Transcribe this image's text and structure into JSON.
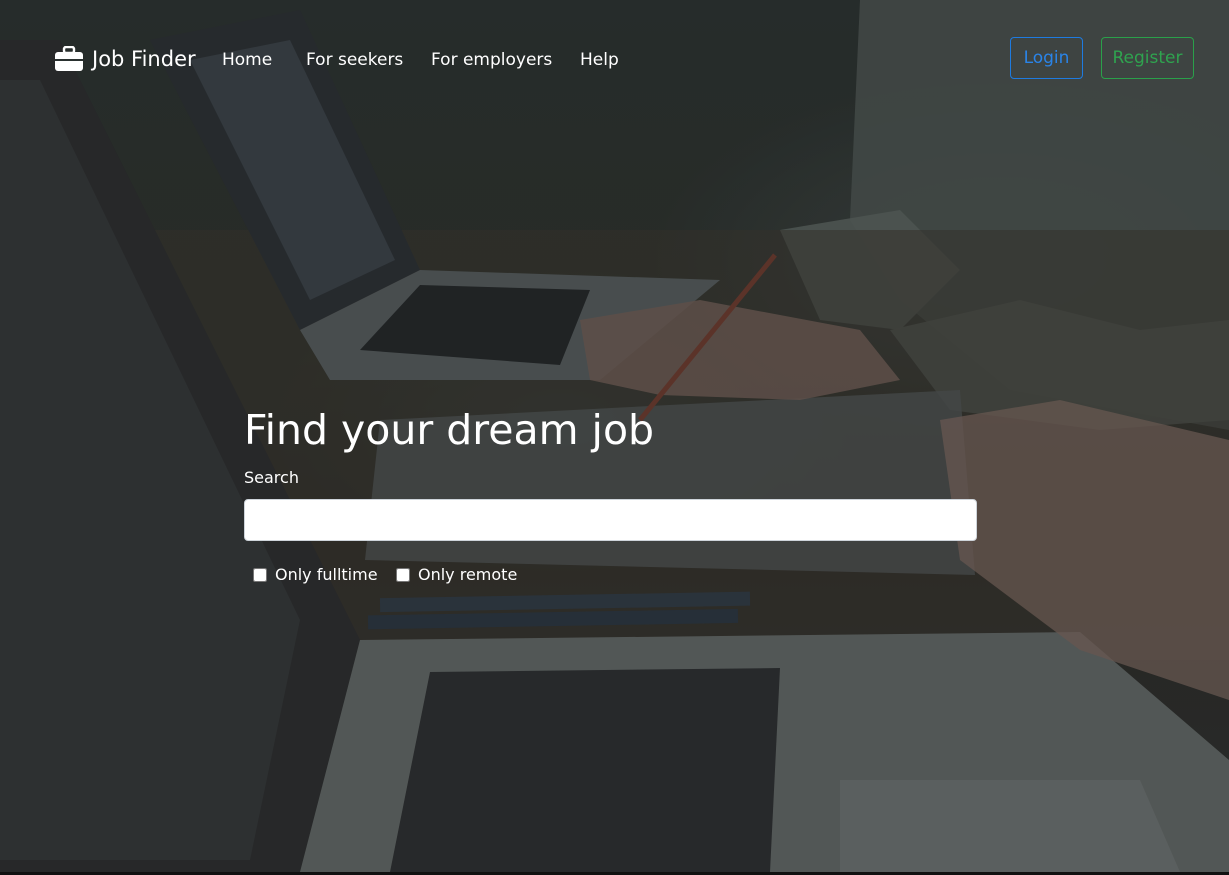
{
  "navbar": {
    "brand": "Job Finder",
    "links": [
      "Home",
      "For seekers",
      "For employers",
      "Help"
    ],
    "login_label": "Login",
    "register_label": "Register"
  },
  "hero": {
    "headline": "Find your dream job",
    "search_label": "Search",
    "search_value": "",
    "filters": [
      {
        "label": "Only fulltime",
        "checked": false
      },
      {
        "label": "Only remote",
        "checked": false
      }
    ]
  },
  "icons": {
    "brand_icon": "briefcase-icon"
  },
  "colors": {
    "login_accent": "#2a84e8",
    "register_accent": "#2fa34f",
    "text": "#ffffff"
  }
}
